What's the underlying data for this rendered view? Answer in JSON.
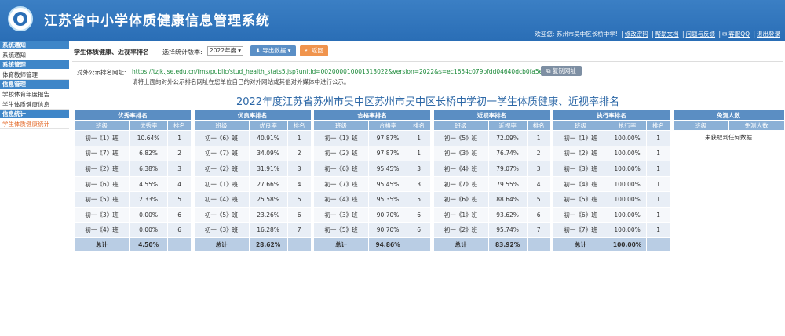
{
  "app": {
    "title": "江苏省中小学体质健康信息管理系统"
  },
  "userbar": {
    "welcome": "欢迎您: 苏州市吴中区长桥中学!",
    "links": [
      "修改密码",
      "帮助文档",
      "问题与反馈",
      "客服QQ",
      "退出登录"
    ]
  },
  "sidebar": {
    "groups": [
      {
        "title": "系统通知",
        "items": [
          "系统通知"
        ]
      },
      {
        "title": "系统管理",
        "items": [
          "体育教师管理"
        ]
      },
      {
        "title": "信息管理",
        "items": [
          "学校体育年度报告",
          "学生体质健康信息"
        ]
      },
      {
        "title": "信息统计",
        "items": [
          "学生体质健康统计"
        ]
      }
    ]
  },
  "toolbar": {
    "title": "学生体质健康、近视率排名",
    "version_label": "选择统计版本:",
    "version_value": "2022年度",
    "export_label": "导出数据",
    "back_label": "返回"
  },
  "public_url": {
    "label": "对外公示排名网址:",
    "value": "https://tzjk.jse.edu.cn/fms/public/stud_health_stats5.jsp?unitId=002000010001313022&version=2022&s=ec1654c079bfdd04640dcb0fa5e0d5b5",
    "copy_label": "复制网址",
    "hint": "请将上面的对外公示排名网址在您单位自己的对外网站或其他对外媒体中进行公示。"
  },
  "report_title": "2022年度江苏省苏州市吴中区苏州市吴中区长桥中学初一学生体质健康、近视率排名",
  "accent": "#2d68a7",
  "tables": [
    {
      "caption": "优秀率排名",
      "cols": [
        "班级",
        "优秀率",
        "排名"
      ],
      "rows": [
        [
          "初一《1》班",
          "10.64%",
          "1"
        ],
        [
          "初一《7》班",
          "6.82%",
          "2"
        ],
        [
          "初一《2》班",
          "6.38%",
          "3"
        ],
        [
          "初一《6》班",
          "4.55%",
          "4"
        ],
        [
          "初一《5》班",
          "2.33%",
          "5"
        ],
        [
          "初一《3》班",
          "0.00%",
          "6"
        ],
        [
          "初一《4》班",
          "0.00%",
          "6"
        ]
      ],
      "total": [
        "总计",
        "4.50%",
        ""
      ]
    },
    {
      "caption": "优良率排名",
      "cols": [
        "班级",
        "优良率",
        "排名"
      ],
      "rows": [
        [
          "初一《6》班",
          "40.91%",
          "1"
        ],
        [
          "初一《7》班",
          "34.09%",
          "2"
        ],
        [
          "初一《2》班",
          "31.91%",
          "3"
        ],
        [
          "初一《1》班",
          "27.66%",
          "4"
        ],
        [
          "初一《4》班",
          "25.58%",
          "5"
        ],
        [
          "初一《5》班",
          "23.26%",
          "6"
        ],
        [
          "初一《3》班",
          "16.28%",
          "7"
        ]
      ],
      "total": [
        "总计",
        "28.62%",
        ""
      ]
    },
    {
      "caption": "合格率排名",
      "cols": [
        "班级",
        "合格率",
        "排名"
      ],
      "rows": [
        [
          "初一《1》班",
          "97.87%",
          "1"
        ],
        [
          "初一《2》班",
          "97.87%",
          "1"
        ],
        [
          "初一《6》班",
          "95.45%",
          "3"
        ],
        [
          "初一《7》班",
          "95.45%",
          "3"
        ],
        [
          "初一《4》班",
          "95.35%",
          "5"
        ],
        [
          "初一《3》班",
          "90.70%",
          "6"
        ],
        [
          "初一《5》班",
          "90.70%",
          "6"
        ]
      ],
      "total": [
        "总计",
        "94.86%",
        ""
      ]
    },
    {
      "caption": "近视率排名",
      "cols": [
        "班级",
        "近视率",
        "排名"
      ],
      "rows": [
        [
          "初一《5》班",
          "72.09%",
          "1"
        ],
        [
          "初一《3》班",
          "76.74%",
          "2"
        ],
        [
          "初一《4》班",
          "79.07%",
          "3"
        ],
        [
          "初一《7》班",
          "79.55%",
          "4"
        ],
        [
          "初一《6》班",
          "88.64%",
          "5"
        ],
        [
          "初一《1》班",
          "93.62%",
          "6"
        ],
        [
          "初一《2》班",
          "95.74%",
          "7"
        ]
      ],
      "total": [
        "总计",
        "83.92%",
        ""
      ]
    },
    {
      "caption": "执行率排名",
      "cols": [
        "班级",
        "执行率",
        "排名"
      ],
      "rows": [
        [
          "初一《1》班",
          "100.00%",
          "1"
        ],
        [
          "初一《2》班",
          "100.00%",
          "1"
        ],
        [
          "初一《3》班",
          "100.00%",
          "1"
        ],
        [
          "初一《4》班",
          "100.00%",
          "1"
        ],
        [
          "初一《5》班",
          "100.00%",
          "1"
        ],
        [
          "初一《6》班",
          "100.00%",
          "1"
        ],
        [
          "初一《7》班",
          "100.00%",
          "1"
        ]
      ],
      "total": [
        "总计",
        "100.00%",
        ""
      ]
    }
  ],
  "exempt_table": {
    "caption": "免测人数",
    "cols": [
      "班级",
      "免测人数"
    ],
    "empty": "未获取到任何数据"
  }
}
